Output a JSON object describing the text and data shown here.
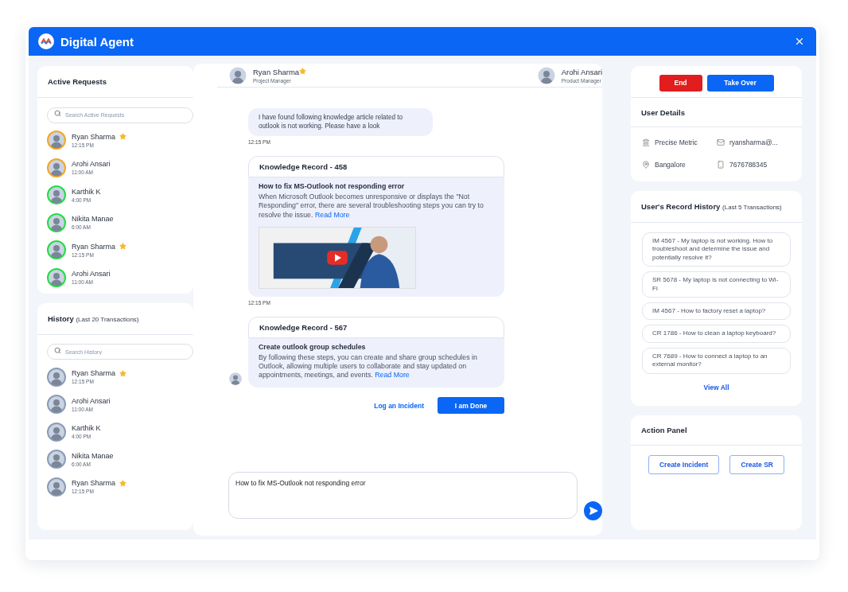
{
  "window": {
    "title": "Digital Agent"
  },
  "active_requests": {
    "title": "Active Requests",
    "search": {
      "placeholder": "Search Active Requests"
    },
    "items": [
      {
        "name": "Ryan Sharma",
        "time": "12:15 PM",
        "favorite": true,
        "color": "#f5a623"
      },
      {
        "name": "Arohi Ansari",
        "time": "11:00 AM",
        "favorite": false,
        "color": "#f5a623"
      },
      {
        "name": "Karthik K",
        "time": "4:00 PM",
        "favorite": false,
        "color": "#22dd44"
      },
      {
        "name": "Nikita Manae",
        "time": "6:00 AM",
        "favorite": false,
        "color": "#22dd44"
      },
      {
        "name": "Ryan Sharma",
        "time": "12:15 PM",
        "favorite": true,
        "color": "#22dd44"
      },
      {
        "name": "Arohi Ansari",
        "time": "11:00 AM",
        "favorite": false,
        "color": "#22dd44"
      }
    ]
  },
  "history": {
    "title": "History",
    "subtitle": "(Last 20 Transactions)",
    "search": {
      "placeholder": "Search History"
    },
    "items": [
      {
        "name": "Ryan Sharma",
        "time": "12:15 PM",
        "favorite": true,
        "color": "#8a9bb8"
      },
      {
        "name": "Arohi Ansari",
        "time": "11:00 AM",
        "favorite": false,
        "color": "#8a9bb8"
      },
      {
        "name": "Karthik K",
        "time": "4:00 PM",
        "favorite": false,
        "color": "#8a9bb8"
      },
      {
        "name": "Nikita Manae",
        "time": "6:00 AM",
        "favorite": false,
        "color": "#8a9bb8"
      },
      {
        "name": "Ryan Sharma",
        "time": "12:15 PM",
        "favorite": true,
        "color": "#8a9bb8"
      }
    ]
  },
  "chat": {
    "user": {
      "name": "Ryan Sharma",
      "role": "Project Manager",
      "favorite": true
    },
    "agent": {
      "name": "Arohi Ansari",
      "role": "Product Manager"
    },
    "messages": [
      {
        "kind": "text",
        "text": "I have found following knowledge article related to outlook is not working. Please have a look",
        "time": "12:15 PM"
      },
      {
        "kind": "article",
        "title": "Knowledge Record - 458",
        "heading": "How to fix MS-Outlook not responding error",
        "body": "When Microsoft Outlook becomes unresponsive or displays the \"Not Responding\" error, there are several troubleshooting steps you can try to resolve the issue.",
        "link": "Read More",
        "video": true,
        "time": "12:15 PM"
      },
      {
        "kind": "article",
        "title": "Knowledge Record - 567",
        "heading": "Create outlook group schedules",
        "body": "By following these steps, you can create and share group schedules in Outlook, allowing multiple users to collaborate and stay updated on appointments, meetings, and events.",
        "link": "Read More",
        "avatar": true
      }
    ],
    "actions": [
      {
        "label": "Log an Incident",
        "kind": "link"
      },
      {
        "label": "I am Done",
        "kind": "primary"
      }
    ],
    "input": {
      "value": "How to fix MS-Outlook not responding error"
    }
  },
  "controls": [
    {
      "label": "End",
      "kind": "danger"
    },
    {
      "label": "Take Over",
      "kind": "primary"
    }
  ],
  "user_details": {
    "title": "User Details",
    "items": [
      {
        "kind": "company",
        "text": "Precise Metric"
      },
      {
        "kind": "email",
        "text": "ryansharma@..."
      },
      {
        "kind": "location",
        "text": "Bangalore"
      },
      {
        "kind": "phone",
        "text": "7676788345"
      }
    ]
  },
  "record_history": {
    "title": "User's Record History",
    "subtitle": "(Last 5 Transactions)",
    "items": [
      "IM 4567 - My laptop is not working.  How to troubleshoot and determine the issue and potentially resolve it?",
      "SR 5678 - My laptop is not connecting to Wi-Fi",
      "IM 4567 - How to factory reset a laptop?",
      "CR 1786 - How to clean a laptop keyboard?",
      "CR 7689 - How to connect a laptop to an external monitor?"
    ],
    "link": "View All"
  },
  "action_panel": {
    "title": "Action Panel",
    "buttons": [
      "Create Incident",
      "Create SR"
    ]
  }
}
